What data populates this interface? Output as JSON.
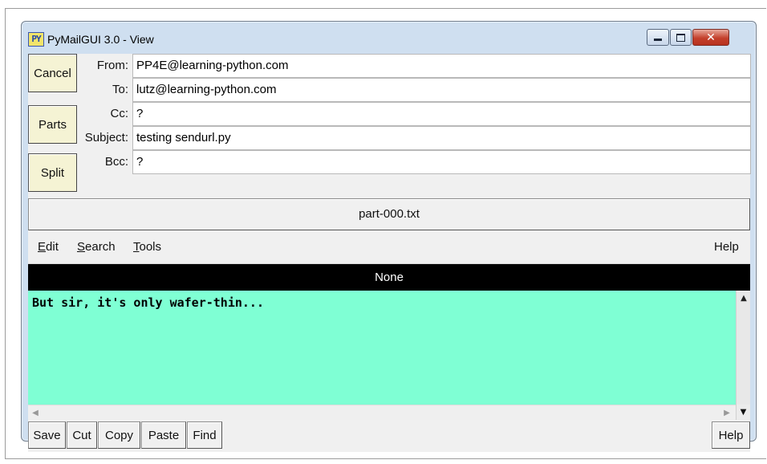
{
  "window": {
    "title": "PyMailGUI 3.0 - View",
    "icon_text": "PY",
    "icon_name": "python-app-icon",
    "close_glyph": "✕"
  },
  "actions": {
    "cancel": "Cancel",
    "parts": "Parts",
    "split": "Split"
  },
  "headers": [
    {
      "label": "From:",
      "value": "PP4E@learning-python.com"
    },
    {
      "label": "To:",
      "value": "lutz@learning-python.com"
    },
    {
      "label": "Cc:",
      "value": "?"
    },
    {
      "label": "Subject:",
      "value": "testing sendurl.py"
    },
    {
      "label": "Bcc:",
      "value": "?"
    }
  ],
  "part_button": "part-000.txt",
  "menu": {
    "edit": {
      "underline": "E",
      "rest": "dit"
    },
    "search": {
      "underline": "S",
      "rest": "earch"
    },
    "tools": {
      "underline": "T",
      "rest": "ools"
    },
    "help": "Help"
  },
  "status": "None",
  "body_text": "But sir, it's only wafer-thin...",
  "toolbar": {
    "save": "Save",
    "cut": "Cut",
    "copy": "Copy",
    "paste": "Paste",
    "find": "Find",
    "help": "Help"
  },
  "colors": {
    "text_background": "#7fffd4",
    "status_background": "#000000",
    "action_button": "#f5f3d4"
  }
}
